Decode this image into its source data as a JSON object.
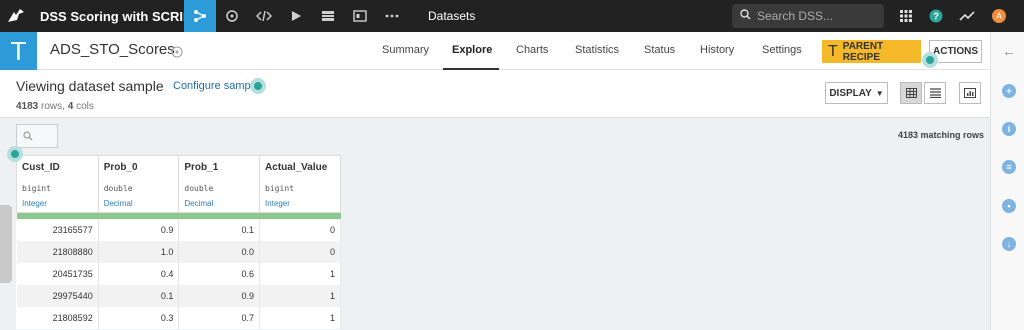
{
  "app": {
    "project_title": "DSS Scoring with SCRIPT",
    "nav_datasets": "Datasets",
    "search_placeholder": "Search DSS...",
    "avatar_letter": "A"
  },
  "dataset": {
    "type_letter": "T",
    "name": "ADS_STO_Scores",
    "tabs": [
      "Summary",
      "Explore",
      "Charts",
      "Statistics",
      "Status",
      "History",
      "Settings"
    ],
    "active_tab": "Explore",
    "parent_recipe_label": "PARENT RECIPE",
    "actions_label": "ACTIONS"
  },
  "sample": {
    "title": "Viewing dataset sample",
    "configure_label": "Configure sample",
    "rows_count": "4183",
    "rows_label": "rows,",
    "cols_count": "4",
    "cols_label": "cols",
    "display_label": "DISPLAY",
    "matching_rows": "4183 matching rows"
  },
  "table": {
    "columns": [
      {
        "name": "Cust_ID",
        "type": "bigint",
        "meaning": "Integer"
      },
      {
        "name": "Prob_0",
        "type": "double",
        "meaning": "Decimal"
      },
      {
        "name": "Prob_1",
        "type": "double",
        "meaning": "Decimal"
      },
      {
        "name": "Actual_Value",
        "type": "bigint",
        "meaning": "Integer"
      }
    ],
    "rows": [
      [
        "23165577",
        "0.9",
        "0.1",
        "0"
      ],
      [
        "21808880",
        "1.0",
        "0.0",
        "0"
      ],
      [
        "20451735",
        "0.4",
        "0.6",
        "1"
      ],
      [
        "29975440",
        "0.1",
        "0.9",
        "1"
      ],
      [
        "21808592",
        "0.3",
        "0.7",
        "1"
      ]
    ]
  },
  "colors": {
    "topbar": "#222222",
    "accent_blue": "#2d9bd8",
    "parent_recipe": "#f5b829",
    "valid_bar": "#8bc88d",
    "hotspot": "#2aa59a"
  }
}
